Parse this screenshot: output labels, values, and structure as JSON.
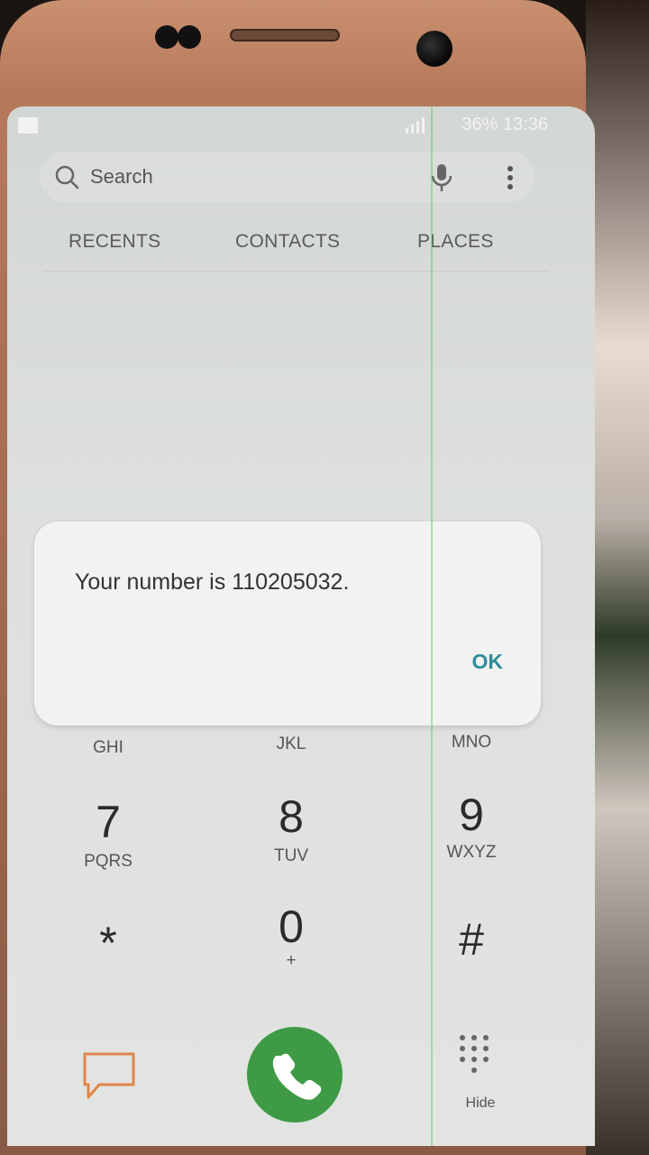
{
  "status_bar": {
    "battery_time": "36% 13:36"
  },
  "search": {
    "placeholder": "Search"
  },
  "tabs": [
    "RECENTS",
    "CONTACTS",
    "PLACES"
  ],
  "dialog": {
    "message": "Your number is 110205032.",
    "ok_label": "OK"
  },
  "keypad": {
    "row3_letters": [
      "GHI",
      "JKL",
      "MNO"
    ],
    "row4": [
      {
        "digit": "7",
        "letters": "PQRS"
      },
      {
        "digit": "8",
        "letters": "TUV"
      },
      {
        "digit": "9",
        "letters": "WXYZ"
      }
    ],
    "row5": [
      {
        "digit": "*",
        "letters": ""
      },
      {
        "digit": "0",
        "letters": "+"
      },
      {
        "digit": "#",
        "letters": ""
      }
    ]
  },
  "bottom": {
    "hide_label": "Hide"
  },
  "colors": {
    "call": "#3f9a46",
    "ok": "#2f8c9a",
    "message_icon": "#e0864a"
  }
}
